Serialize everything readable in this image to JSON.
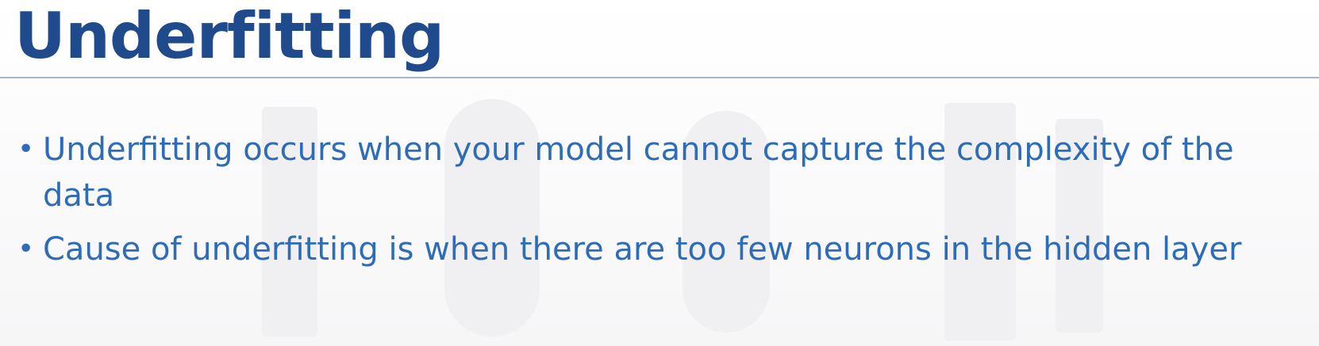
{
  "slide": {
    "title": "Underfitting",
    "bullets": [
      {
        "text": "Underfitting occurs when your model cannot capture the complexity of the data"
      },
      {
        "text": "Cause of underfitting is when there are too few neurons in the hidden layer"
      }
    ]
  },
  "colors": {
    "title": "#1f4b8c",
    "body_text": "#2e6cb8",
    "divider": "#9fb6d4",
    "background": "#fbfbfc"
  }
}
